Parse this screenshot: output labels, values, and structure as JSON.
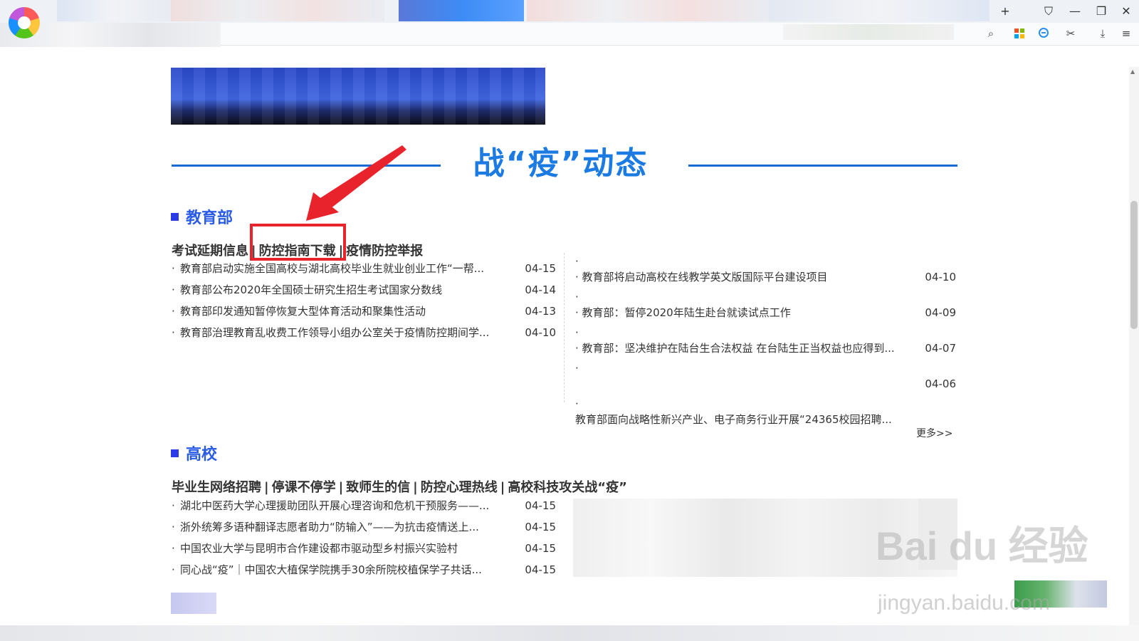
{
  "section_title": "战“疫”动态",
  "education": {
    "heading": "教育部",
    "links": [
      "考试延期信息",
      "防控指南下载",
      "疫情防控举报"
    ],
    "left_items": [
      {
        "title": "教育部启动实施全国高校与湖北高校毕业生就业创业工作“一帮...",
        "date": "04-15"
      },
      {
        "title": "教育部公布2020年全国硕士研究生招生考试国家分数线",
        "date": "04-14"
      },
      {
        "title": "教育部印发通知暂停恢复大型体育活动和聚集性活动",
        "date": "04-13"
      },
      {
        "title": "教育部治理教育乱收费工作领导小组办公室关于疫情防控期间学...",
        "date": "04-10"
      }
    ],
    "right_items": [
      {
        "title": "教育部将启动高校在线教学英文版国际平台建设项目",
        "date": "04-10"
      },
      {
        "title": "教育部：暂停2020年陆生赴台就读试点工作",
        "date": "04-09"
      },
      {
        "title": "教育部：坚决维护在陆台生合法权益 在台陆生正当权益也应得到...",
        "date": "04-07"
      },
      {
        "title": "",
        "date": "04-06"
      },
      {
        "title": "教育部面向战略性新兴产业、电子商务行业开展“24365校园招聘...",
        "date": ""
      }
    ],
    "more": "更多>>"
  },
  "universities": {
    "heading": "高校",
    "links": [
      "毕业生网络招聘",
      "停课不停学",
      "致师生的信",
      "防控心理热线",
      "高校科技攻关战“疫”"
    ],
    "left_items": [
      {
        "title": "湖北中医药大学心理援助团队开展心理咨询和危机干预服务——...",
        "date": "04-15"
      },
      {
        "title": "浙外统筹多语种翻译志愿者助力“防输入”——为抗击疫情送上...",
        "date": "04-15"
      },
      {
        "title": "中国农业大学与昆明市合作建设都市驱动型乡村振兴实验村",
        "date": "04-15"
      },
      {
        "title": "同心战“疫”｜中国农大植保学院携手30余所院校植保学子共话...",
        "date": "04-15"
      }
    ]
  },
  "watermark": {
    "main": "Bai du 经验",
    "sub": "jingyan.baidu.com"
  },
  "colors": {
    "accent_blue": "#1b7be3",
    "highlight_red": "#e8232b",
    "heading_blue": "#2b5ce6"
  },
  "toolbar": {
    "new_tab": "+",
    "skin": "⛉",
    "minimize": "—",
    "restore": "❐",
    "close": "✕",
    "search": "⌕",
    "cut": "✂",
    "download": "⤓",
    "menu": "≡"
  }
}
